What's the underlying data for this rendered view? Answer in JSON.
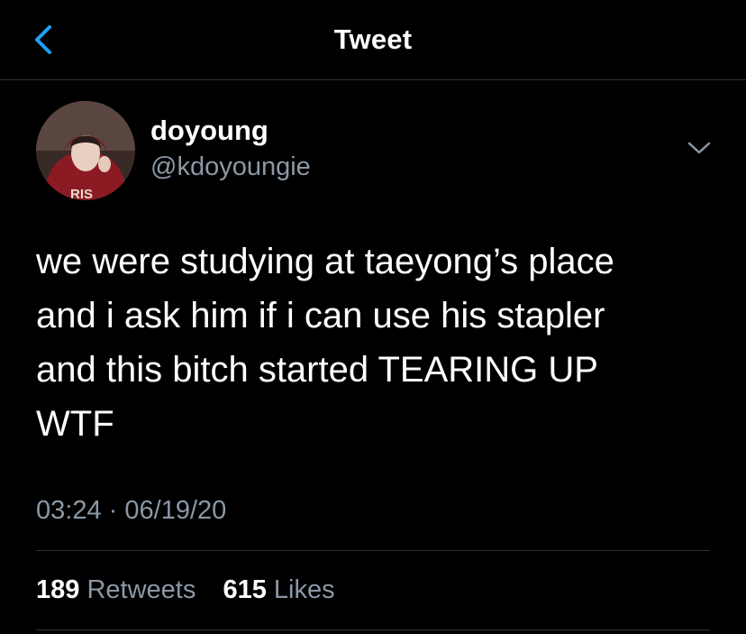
{
  "header": {
    "title": "Tweet",
    "back_icon": "chevron-left-icon",
    "accent_color": "#1da1f2"
  },
  "author": {
    "display_name": "doyoung",
    "handle": "@kdoyoungie",
    "avatar_text": "RIS"
  },
  "tweet": {
    "text": "we were studying at taeyong’s place\nand i ask him if i can use his stapler\nand this bitch started TEARING UP\nWTF",
    "time": "03:24",
    "separator": "·",
    "date": "06/19/20",
    "menu_icon": "chevron-down-icon"
  },
  "stats": {
    "retweets_count": "189",
    "retweets_label": "Retweets",
    "likes_count": "615",
    "likes_label": "Likes"
  },
  "colors": {
    "background": "#000000",
    "secondary_text": "#8b98a5",
    "divider": "#2f3336"
  }
}
